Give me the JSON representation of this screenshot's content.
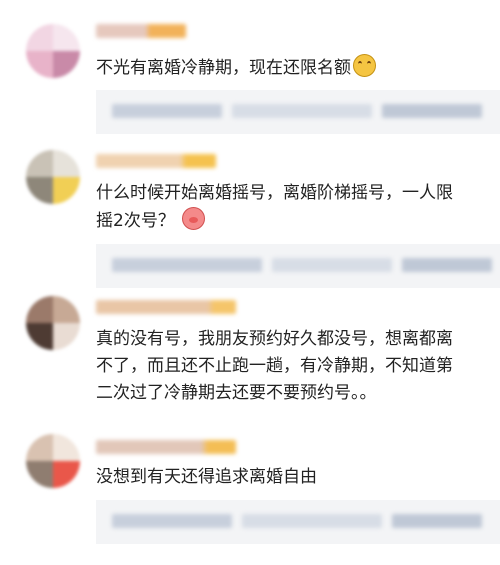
{
  "comments": [
    {
      "lines": [
        "不光有离婚冷静期，现在还限名额"
      ],
      "emoji": "smile-emoji",
      "avatar_colors": [
        "#f2d6e3",
        "#e8b3c9",
        "#f6e6ee",
        "#c98aa8"
      ],
      "name_colors": [
        "#e6c8bd",
        "#f2b25a"
      ]
    },
    {
      "lines": [
        "什么时候开始离婚摇号，离婚阶梯摇号，一人限",
        "摇2次号？"
      ],
      "emoji": "pig-emoji",
      "avatar_colors": [
        "#c9c2b6",
        "#8e877a",
        "#e6e2da",
        "#f1cf55"
      ],
      "name_colors": [
        "#f0d2b0",
        "#f5c24f"
      ]
    },
    {
      "lines": [
        "真的没有号，我朋友预约好久都没号，想离都离",
        "不了，而且还不止跑一趟，有冷静期，不知道第",
        "二次过了冷静期去还要不要预约号。。"
      ],
      "emoji": "",
      "avatar_colors": [
        "#9b7a6a",
        "#4e3b33",
        "#c7a995",
        "#e9dcd3"
      ],
      "name_colors": [
        "#e9c6a6",
        "#f5c56a"
      ]
    },
    {
      "lines": [
        "没想到有天还得追求离婚自由"
      ],
      "emoji": "",
      "avatar_colors": [
        "#d9c2b1",
        "#8f7d70",
        "#f1e6dd",
        "#e9574a"
      ],
      "name_colors": [
        "#e2c7b9",
        "#f4be55"
      ]
    }
  ],
  "quote_colors": [
    "#c7cfdc",
    "#d7dde6",
    "#bfc8d6"
  ]
}
